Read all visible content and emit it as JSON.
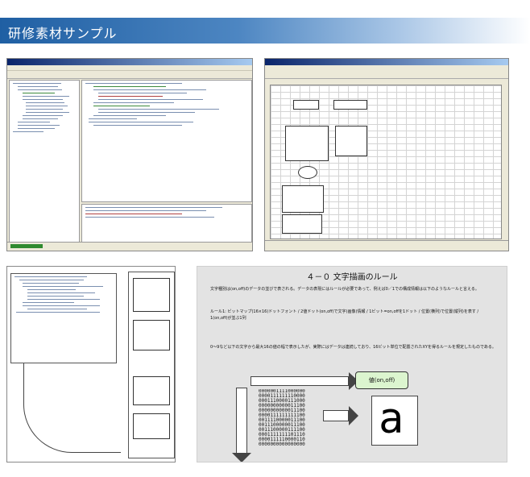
{
  "header": {
    "title": "研修素材サンプル"
  },
  "slide": {
    "title": "４－０ 文字描画のルール",
    "paragraph1": "文字種別は(on,off)のデータの並びで表される。データの表現にはルールが必要であって、例えば0／1での構成情報は以下のようなルールと言える。",
    "paragraph2": "ルール1: ビットマップ(16×16)ドットフォント / 2値ドット(on,off)で文字(画像)情報 / 1ビット=on,offを1ドット / 位置(横列)で位置(縦列)を表す / 1(on,off)が並ぶ1列",
    "paragraph3": "0～9など以下の文字から最大16の値の幅で表示したが、実際にはデータは連続しており、16ビット単位で配置されたXYを得るルールを規定したものである。",
    "callout": "値(on,off)",
    "bits": "0000001111000000\n0000111111110000\n0001110000111000\n0000000000011100\n0000000000011100\n0000111111111100\n0011110000011100\n0011100000011100\n0011100000111100\n0001111111101110\n0000111110000110\n0000000000000000",
    "glyph": "a"
  }
}
